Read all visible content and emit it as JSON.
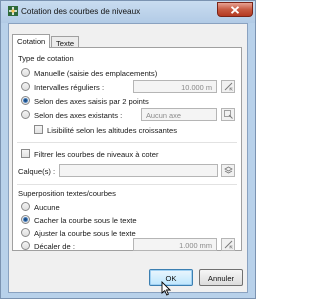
{
  "window": {
    "title": "Cotation des courbes de niveaux",
    "close_label": "X"
  },
  "tabs": [
    {
      "label": "Cotation",
      "active": true
    },
    {
      "label": "Texte",
      "active": false
    }
  ],
  "type_cotation": {
    "heading": "Type de cotation",
    "options": [
      {
        "label": "Manuelle (saisie des emplacements)",
        "selected": false
      },
      {
        "label": "Intervalles réguliers :",
        "selected": false
      },
      {
        "label": "Selon des axes saisis par 2 points",
        "selected": true
      },
      {
        "label": "Selon des axes existants :",
        "selected": false
      }
    ],
    "interval_value": "10.000 m",
    "axes_value": "Aucun axe",
    "lisibilite_label": "Lisibilité selon les altitudes croissantes",
    "lisibilite_checked": false
  },
  "filtre": {
    "label": "Filtrer les courbes de niveaux à coter",
    "checked": false,
    "calques_label": "Calque(s) :",
    "calques_value": ""
  },
  "superposition": {
    "heading": "Superposition textes/courbes",
    "options": [
      {
        "label": "Aucune",
        "selected": false
      },
      {
        "label": "Cacher la courbe sous le texte",
        "selected": true
      },
      {
        "label": "Ajuster la courbe sous le texte",
        "selected": false
      },
      {
        "label": "Décaler de :",
        "selected": false
      }
    ],
    "decaler_value": "1.000 mm"
  },
  "buttons": {
    "ok": "OK",
    "cancel": "Annuler"
  },
  "colors": {
    "title_bar": "#b8d1ea",
    "close_button": "#c75a42",
    "radio_selected": "#1c4f86"
  }
}
